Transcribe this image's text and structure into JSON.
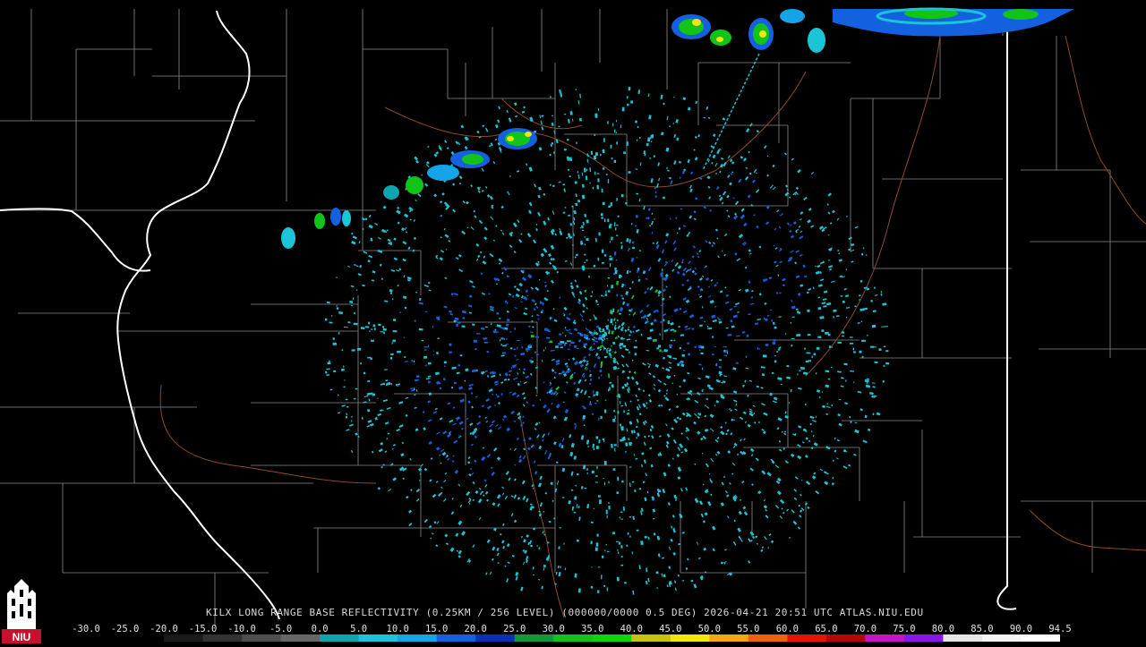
{
  "caption": "KILX LONG RANGE BASE REFLECTIVITY (0.25KM / 256 LEVEL) (000000/0000 0.5 DEG) 2026-04-21 20:51 UTC  ATLAS.NIU.EDU",
  "logo_text": "NIU",
  "colorbar": {
    "labels": [
      "-30.0",
      "-25.0",
      "-20.0",
      "-15.0",
      "-10.0",
      "-5.0",
      "0.0",
      "5.0",
      "10.0",
      "15.0",
      "20.0",
      "25.0",
      "30.0",
      "35.0",
      "40.0",
      "45.0",
      "50.0",
      "55.0",
      "60.0",
      "65.0",
      "70.0",
      "75.0",
      "80.0",
      "85.0",
      "90.0",
      "94.5"
    ],
    "colors": [
      "#000000",
      "#000000",
      "#1a1a1a",
      "#333333",
      "#4d4d4d",
      "#666666",
      "#0ea5ad",
      "#19c5d6",
      "#14a5e8",
      "#1461e0",
      "#0d2fb8",
      "#0f9a3a",
      "#12c418",
      "#0ed40b",
      "#c9c20c",
      "#f2e60a",
      "#f5a60c",
      "#f0620a",
      "#e2140a",
      "#b5060a",
      "#c814c8",
      "#8c14e6",
      "#e6e6e6",
      "#f6f6f6",
      "#ffffff"
    ],
    "bright_start": 6
  },
  "map_colors": {
    "county": "#8a8a8a",
    "state": "#ffffff",
    "river": "#8b4b2a",
    "light_echo": "#19c5d6",
    "mid_echo": "#1461e0",
    "strong_echo": "#12c418",
    "core_echo": "#f2e60a"
  }
}
